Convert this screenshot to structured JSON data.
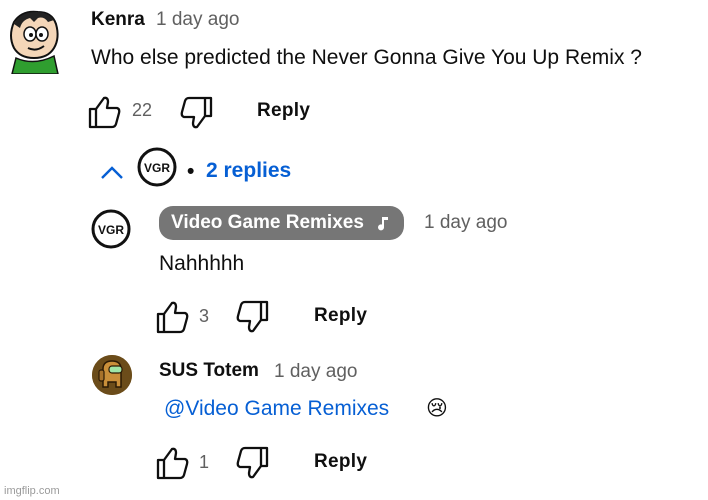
{
  "comment": {
    "author": "Kenra",
    "time": "1 day ago",
    "text": "Who else predicted the Never Gonna Give You Up Remix ?",
    "likes": "22",
    "reply_label": "Reply"
  },
  "replies_toggle": {
    "label": "2 replies",
    "separator": "•",
    "avatar_text": "VGR"
  },
  "replies": [
    {
      "author": "Video Game Remixes",
      "author_badge_icon": "music-note-icon",
      "time": "1 day ago",
      "text": "Nahhhhh",
      "likes": "3",
      "reply_label": "Reply",
      "avatar_text": "VGR"
    },
    {
      "author": "SUS Totem",
      "time": "1 day ago",
      "mention": "@Video Game Remixes",
      "emoji": "😢",
      "likes": "1",
      "reply_label": "Reply"
    }
  ],
  "icons": [
    "thumbs-up-icon",
    "thumbs-down-icon",
    "chevron-up-icon",
    "music-note-icon"
  ],
  "colors": {
    "link": "#065fd4",
    "chip": "#767676",
    "meta": "#606060"
  },
  "watermark": "imgflip.com"
}
